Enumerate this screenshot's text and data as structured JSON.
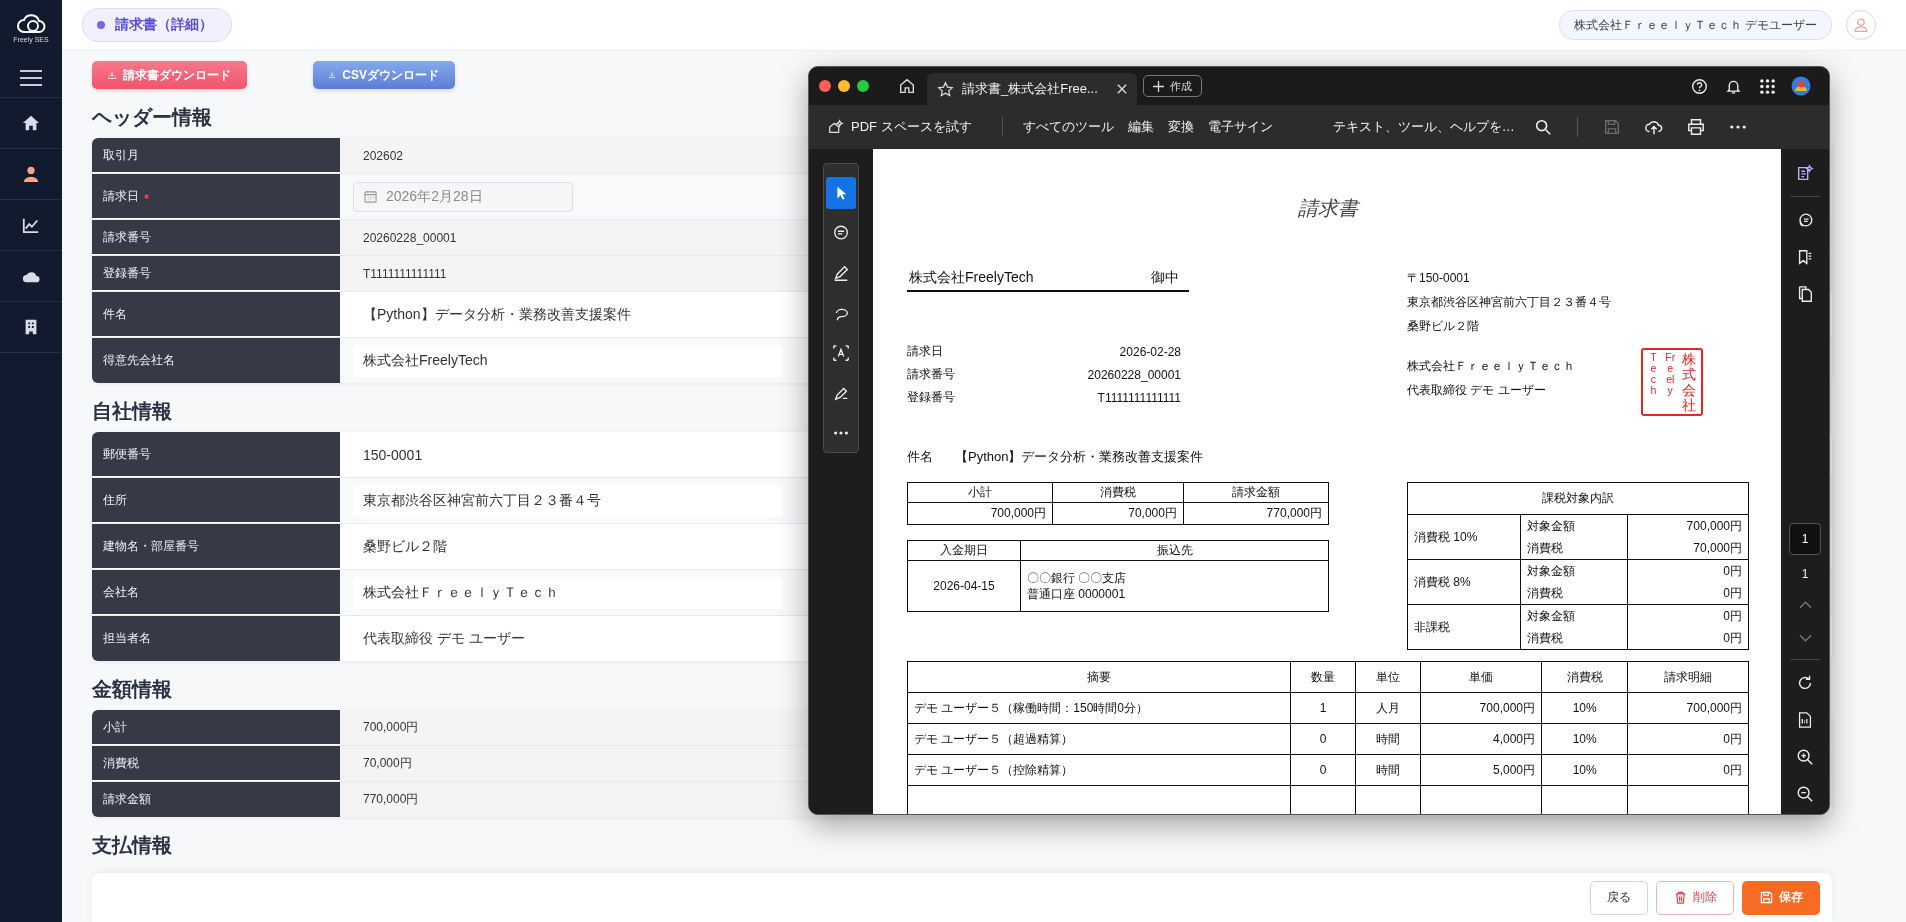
{
  "sidebar": {
    "logo_text": "Freely SES",
    "items": [
      {
        "selected": false
      },
      {
        "selected": true
      },
      {
        "selected": false
      },
      {
        "selected": false
      },
      {
        "selected": false
      }
    ]
  },
  "header": {
    "page_title": "請求書（詳細）",
    "user": "株式会社ＦｒｅｅｌｙＴｅｃｈ デモユーザー"
  },
  "actions": [
    {
      "label": "請求書ダウンロード",
      "kind": "pdf"
    },
    {
      "label": "CSVダウンロード",
      "kind": "csv"
    }
  ],
  "sections": [
    {
      "title": "ヘッダー情報",
      "rows": [
        {
          "label": "取引月",
          "required": false,
          "kind": "readonly",
          "value": "202602"
        },
        {
          "label": "請求日",
          "required": true,
          "kind": "date",
          "value": "2026年2月28日"
        },
        {
          "label": "請求番号",
          "required": false,
          "kind": "readonly",
          "value": "20260228_00001"
        },
        {
          "label": "登録番号",
          "required": false,
          "kind": "readonly",
          "value": "T1111111111111"
        },
        {
          "label": "件名",
          "required": false,
          "kind": "text",
          "value": "【Python】データ分析・業務改善支援案件"
        },
        {
          "label": "得意先会社名",
          "required": false,
          "kind": "input",
          "value": "株式会社FreelyTech"
        }
      ]
    },
    {
      "title": "自社情報",
      "rows": [
        {
          "label": "郵便番号",
          "required": false,
          "kind": "text",
          "value": "150-0001"
        },
        {
          "label": "住所",
          "required": false,
          "kind": "input",
          "value": "東京都渋谷区神宮前六丁目２３番４号"
        },
        {
          "label": "建物名・部屋番号",
          "required": false,
          "kind": "text",
          "value": "桑野ビル２階"
        },
        {
          "label": "会社名",
          "required": false,
          "kind": "input",
          "value": "株式会社ＦｒｅｅｌｙＴｅｃｈ"
        },
        {
          "label": "担当者名",
          "required": false,
          "kind": "text",
          "value": "代表取締役 デモ ユーザー"
        }
      ]
    },
    {
      "title": "金額情報",
      "rows": [
        {
          "label": "小計",
          "required": false,
          "kind": "readonly",
          "value": "700,000円"
        },
        {
          "label": "消費税",
          "required": false,
          "kind": "readonly",
          "value": "70,000円"
        },
        {
          "label": "請求金額",
          "required": false,
          "kind": "readonly",
          "value": "770,000円"
        }
      ]
    },
    {
      "title": "支払情報"
    }
  ],
  "footer": {
    "buttons": [
      {
        "label": "戻る",
        "kind": "back"
      },
      {
        "label": "削除",
        "kind": "delete"
      },
      {
        "label": "保存",
        "kind": "save"
      }
    ]
  },
  "pdf_viewer": {
    "tab_title": "請求書_株式会社Free...",
    "new_button": "作成",
    "toolbar": {
      "try_label": "PDF スペースを試す",
      "menu": [
        "すべてのツール",
        "編集",
        "変換",
        "電子サイン"
      ],
      "search": "テキスト、ツール、ヘルプを…"
    },
    "tools": [
      {
        "selected": true
      },
      {
        "selected": false
      },
      {
        "selected": false
      },
      {
        "selected": false
      },
      {
        "selected": false
      },
      {
        "selected": false
      },
      {
        "selected": false
      }
    ],
    "page_number": "1",
    "page_count": "1",
    "document": {
      "title": "請求書",
      "recipient": "株式会社FreelyTech",
      "honorific": "御中",
      "info": [
        {
          "label": "請求日",
          "value": "2026-02-28"
        },
        {
          "label": "請求番号",
          "value": "20260228_00001"
        },
        {
          "label": "登録番号",
          "value": "T1111111111111"
        }
      ],
      "issuer": {
        "postal": "〒150-0001",
        "address": "東京都渋谷区神宮前六丁目２３番４号",
        "building": "桑野ビル２階",
        "company": "株式会社ＦｒｅｅｌｙＴｅｃｈ",
        "representative": "代表取締役 デモ ユーザー"
      },
      "seal": [
        "Tech",
        "Freely",
        "株式会社"
      ],
      "subject": {
        "label": "件名",
        "value": "【Python】データ分析・業務改善支援案件"
      },
      "summary": {
        "columns": [
          "小計",
          "消費税",
          "請求金額"
        ],
        "values": [
          "700,000円",
          "70,000円",
          "770,000円"
        ]
      },
      "payment": {
        "columns": [
          "入金期日",
          "振込先"
        ],
        "due": "2026-04-15",
        "bank": [
          "〇〇銀行 〇〇支店",
          "普通口座 0000001"
        ]
      },
      "tax": {
        "title": "課税対象内訳",
        "groups": [
          {
            "label": "消費税 10%",
            "lines": [
              {
                "label": "対象金額",
                "value": "700,000円"
              },
              {
                "label": "消費税",
                "value": "70,000円"
              }
            ]
          },
          {
            "label": "消費税 8%",
            "lines": [
              {
                "label": "対象金額",
                "value": "0円"
              },
              {
                "label": "消費税",
                "value": "0円"
              }
            ]
          },
          {
            "label": "非課税",
            "lines": [
              {
                "label": "対象金額",
                "value": "0円"
              },
              {
                "label": "消費税",
                "value": "0円"
              }
            ]
          }
        ]
      },
      "details": {
        "columns": [
          "摘要",
          "数量",
          "単位",
          "単価",
          "消費税",
          "請求明細"
        ],
        "rows": [
          [
            "デモ ユーザー５（稼働時間：150時間0分）",
            "1",
            "人月",
            "700,000円",
            "10%",
            "700,000円"
          ],
          [
            "デモ ユーザー５（超過精算）",
            "0",
            "時間",
            "4,000円",
            "10%",
            "0円"
          ],
          [
            "デモ ユーザー５（控除精算）",
            "0",
            "時間",
            "5,000円",
            "10%",
            "0円"
          ]
        ]
      }
    }
  }
}
